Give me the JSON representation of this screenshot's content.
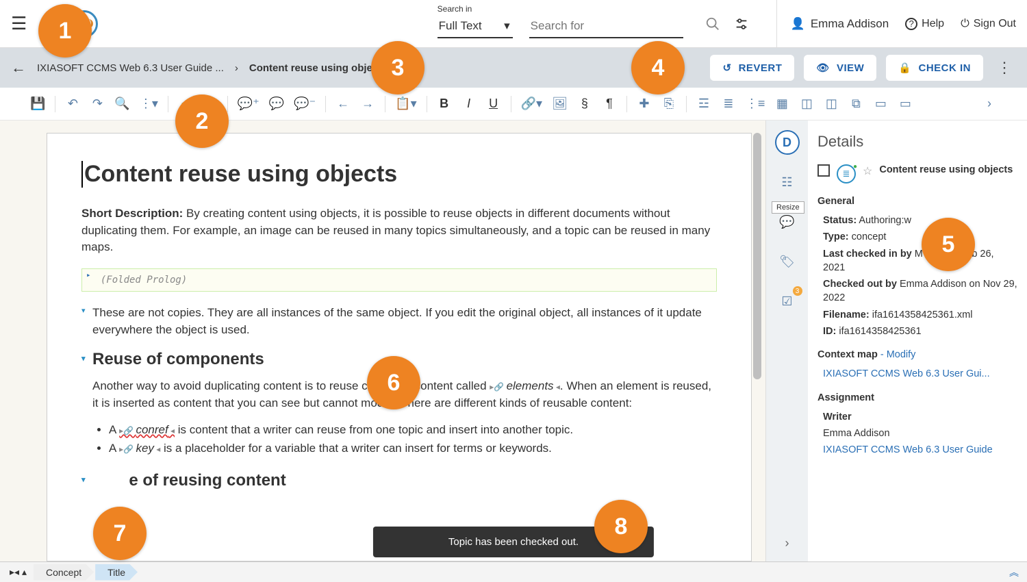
{
  "header": {
    "search_in_label": "Search in",
    "search_in_value": "Full Text",
    "search_for_placeholder": "Search for",
    "user_name": "Emma Addison",
    "help_label": "Help",
    "signout_label": "Sign Out"
  },
  "crumb": {
    "root": "IXIASOFT CCMS Web 6.3 User Guide ...",
    "current": "Content reuse using objects",
    "revert_label": "REVERT",
    "view_label": "VIEW",
    "checkin_label": "CHECK IN"
  },
  "document": {
    "title": "Content reuse using objects",
    "shortdesc_label": "Short Description:",
    "shortdesc_text": "By creating content using objects, it is possible to reuse objects in different documents without duplicating them. For example, an image can be reused in many topics simultaneously, and a topic can be reused in many maps.",
    "prolog_text": "(Folded Prolog)",
    "para1": "These are not copies. They are all instances of the same object. If you edit the original object, all instances of it update everywhere the object is used.",
    "section1_title": "Reuse of components",
    "section1_para_a": "Another way to avoid duplicating content is to reuse chunks of content called ",
    "section1_chip": "elements",
    "section1_para_b": ". When an element is reused, it is inserted as content that you can see but cannot modify. There are different kinds of reusable content:",
    "li1_pre": "A ",
    "li1_chip": "conref",
    "li1_post": " is content that a writer can reuse from one topic and insert into another topic.",
    "li2_pre": "A ",
    "li2_chip": "key",
    "li2_post": " is a placeholder for a variable that a writer can insert for terms or keywords.",
    "section2_title_partial": "e of reusing content"
  },
  "rightrail": {
    "resize_tooltip": "Resize",
    "review_badge": "3"
  },
  "details": {
    "panel_title": "Details",
    "object_title": "Content reuse using objects",
    "general_label": "General",
    "status_label": "Status:",
    "status_value": "Authoring:w",
    "type_label": "Type:",
    "type_value": "concept",
    "lastcheckin_label": "Last checked in by",
    "lastcheckin_value": "M Test on Feb 26, 2021",
    "checkedout_label": "Checked out by",
    "checkedout_value": "Emma Addison on Nov 29, 2022",
    "filename_label": "Filename:",
    "filename_value": "ifa1614358425361.xml",
    "id_label": "ID:",
    "id_value": "ifa1614358425361",
    "contextmap_label": "Context map",
    "contextmap_modify": "- Modify",
    "contextmap_value": "IXIASOFT CCMS Web 6.3 User Gui...",
    "assignment_label": "Assignment",
    "writer_label": "Writer",
    "writer_name": "Emma Addison",
    "writer_guide": "IXIASOFT CCMS Web 6.3 User Guide"
  },
  "statusbar": {
    "chip1": "Concept",
    "chip2": "Title"
  },
  "toast": {
    "message": "Topic has been checked out."
  },
  "callouts": {
    "c1": "1",
    "c2": "2",
    "c3": "3",
    "c4": "4",
    "c5": "5",
    "c6": "6",
    "c7": "7",
    "c8": "8"
  }
}
